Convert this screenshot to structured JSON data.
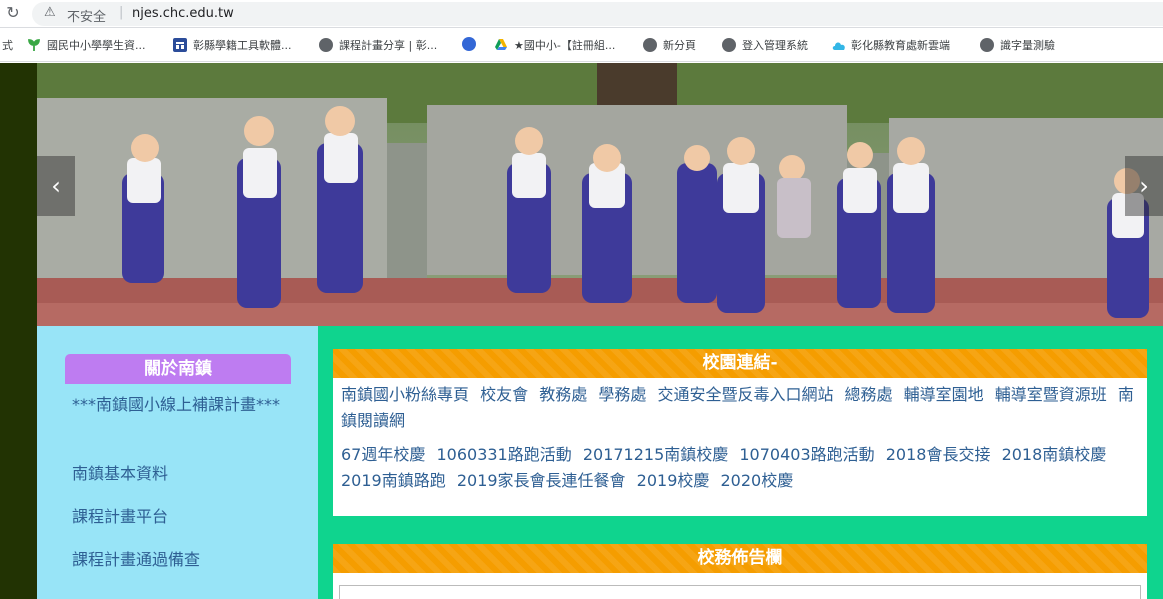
{
  "browser": {
    "insecure_label": "不安全",
    "separator": "|",
    "url": "njes.chc.edu.tw",
    "bookmarks": [
      {
        "label": "式",
        "icon": "none",
        "color": ""
      },
      {
        "label": "國民中小學學生資...",
        "icon": "sprout-icon",
        "color": "#3aa845"
      },
      {
        "label": "彰縣學籍工具軟體...",
        "icon": "app-icon",
        "color": "#2b4c9a"
      },
      {
        "label": "課程計畫分享 | 彰...",
        "icon": "globe-icon",
        "color": "#5f6368"
      },
      {
        "label": "",
        "icon": "link-icon",
        "color": "#3367d6"
      },
      {
        "label": "★國中小-【註冊組...",
        "icon": "drive-icon",
        "color": "#f4b400"
      },
      {
        "label": "新分頁",
        "icon": "globe-icon",
        "color": "#5f6368"
      },
      {
        "label": "登入管理系統",
        "icon": "globe-icon",
        "color": "#5f6368"
      },
      {
        "label": "彰化縣教育處新雲端",
        "icon": "cloud-icon",
        "color": "#33b6e6"
      },
      {
        "label": "識字量測驗",
        "icon": "globe-icon",
        "color": "#5f6368"
      }
    ]
  },
  "banner": {
    "prev_glyph": "‹",
    "next_glyph": "›"
  },
  "sidebar": {
    "title": "關於南鎮",
    "items": [
      "***南鎮國小線上補課計畫***",
      "南鎮基本資料",
      "課程計畫平台",
      "課程計畫通過備查"
    ]
  },
  "links_box": {
    "title": "校園連結-",
    "group1": [
      "南鎮國小粉絲專頁",
      "校友會",
      "教務處",
      "學務處",
      "交通安全暨反毒入口網站",
      "總務處",
      "輔導室園地",
      "輔導室暨資源班",
      "南鎮閱讀網"
    ],
    "group2": [
      "67週年校慶",
      "1060331路跑活動",
      "20171215南鎮校慶",
      "1070403路跑活動",
      "2018會長交接",
      "2018南鎮校慶",
      "2019南鎮路跑",
      "2019家長會長連任餐會",
      "2019校慶",
      "2020校慶"
    ]
  },
  "notice_box": {
    "title": "校務佈告欄"
  },
  "colors": {
    "rail": "#223303",
    "sidebar_bg": "#98e4f7",
    "sidebar_head": "#be7cf1",
    "main_bg": "#0fd48e",
    "box_head": "#f59d00",
    "link": "#2e5f93"
  }
}
